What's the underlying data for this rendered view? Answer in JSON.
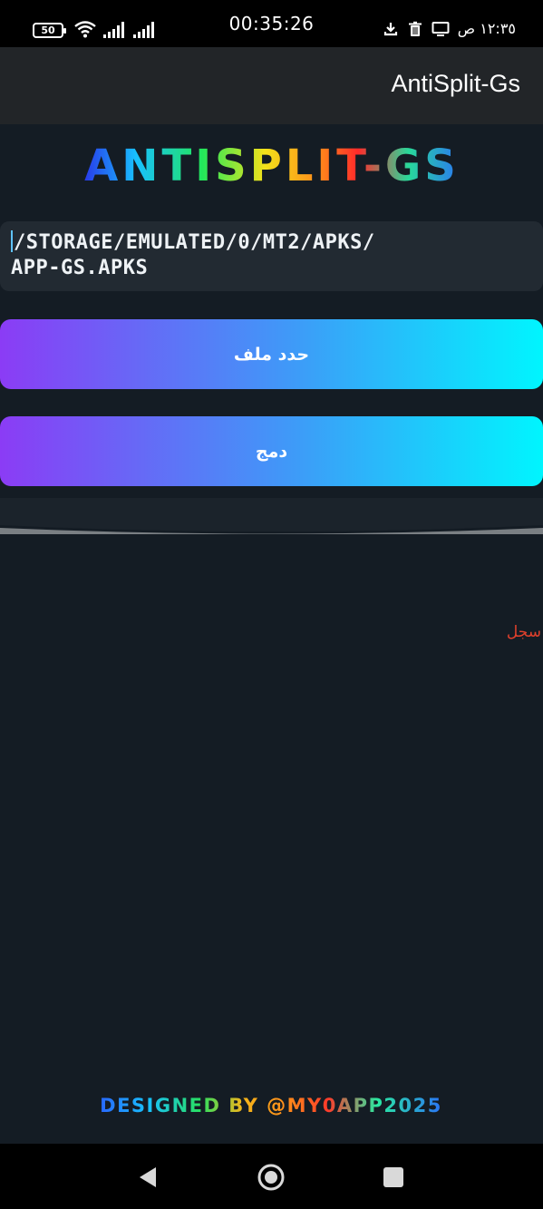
{
  "status_bar": {
    "battery_level": "50",
    "clock": "00:35:26",
    "right_time": "١٢:٣٥ ص",
    "icons": [
      "battery-icon",
      "wifi-icon",
      "signal-icon",
      "download-icon",
      "trash-icon",
      "cast-icon"
    ]
  },
  "app_bar": {
    "title": "AntiSplit-Gs"
  },
  "logo": {
    "text": "ANTISPLIT-GS",
    "gradient": [
      "#2a2ae8",
      "#18c0ff",
      "#22e85a",
      "#f4e21a",
      "#ff8a1a",
      "#ff2a2a",
      "#28d99a",
      "#2a6aff"
    ]
  },
  "path_field": {
    "value_line1": "/storage/emulated/0/MT2/apks/",
    "value_line2": "app-Gs.apks"
  },
  "buttons": {
    "select_file": "حدد ملف",
    "merge": "دمج"
  },
  "log": {
    "label": "سجل"
  },
  "footer": {
    "text": "DESIGNED BY @MY0APP2025"
  },
  "nav_bar": {
    "icons": [
      "back-icon",
      "home-icon",
      "recents-icon"
    ]
  },
  "colors": {
    "background": "#141c24",
    "app_bar": "#222528",
    "field": "#222a32",
    "button_gradient_start": "#8b3cf5",
    "button_gradient_end": "#00f5fe",
    "log_label": "#e0402c"
  }
}
